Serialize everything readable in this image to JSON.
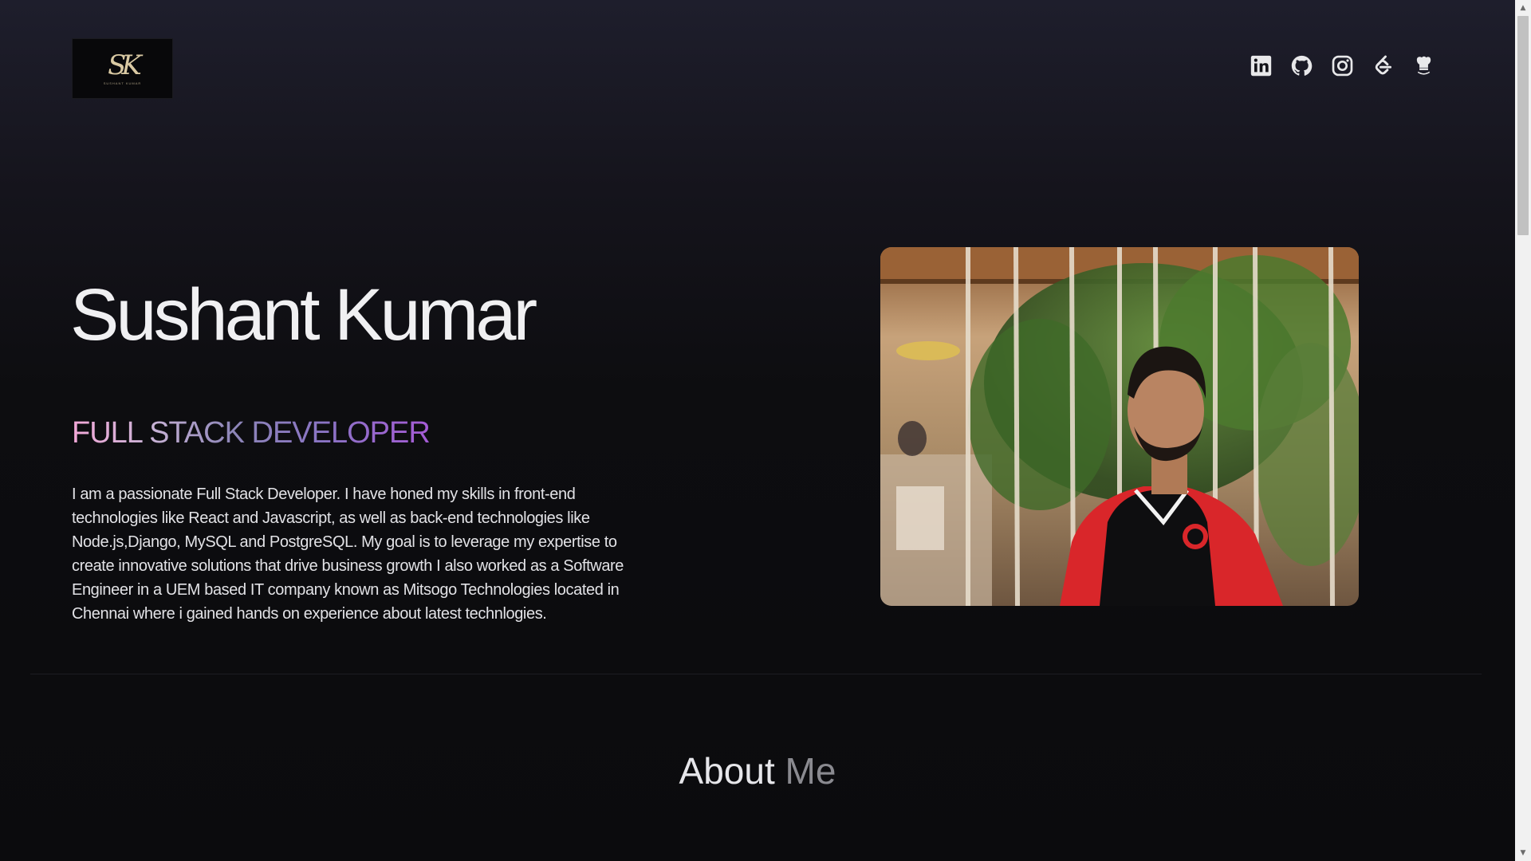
{
  "header": {
    "logo": {
      "mark": "SK",
      "subtitle": "SUSHANT KUMAR"
    },
    "socials": [
      {
        "icon": "linkedin-icon",
        "label": "LinkedIn"
      },
      {
        "icon": "github-icon",
        "label": "GitHub"
      },
      {
        "icon": "instagram-icon",
        "label": "Instagram"
      },
      {
        "icon": "leetcode-icon",
        "label": "LeetCode"
      },
      {
        "icon": "codechef-icon",
        "label": "CodeChef"
      }
    ]
  },
  "hero": {
    "name": "Sushant Kumar",
    "role": "FULL STACK DEVELOPER",
    "bio": "I am a passionate Full Stack Developer. I have honed my skills in front-end technologies like React and Javascript, as well as back-end technologies like Node.js,Django, MySQL and PostgreSQL. My goal is to leverage my expertise to create innovative solutions that drive business growth I also worked as a Software Engineer in a UEM based IT company known as Mitsogo Technologies located in Chennai where i gained hands on experience about latest technlogies.",
    "photo_alt": "Sushant Kumar portrait"
  },
  "about": {
    "heading_word1": "About",
    "heading_word2": "Me"
  },
  "colors": {
    "background": "#0b0b0d",
    "gradient_top": "#1e1e2c",
    "role_gradient_start": "#f3a8d8",
    "role_gradient_end": "#a55bd6",
    "text": "#e8e8ea",
    "muted": "#8a8a90"
  }
}
